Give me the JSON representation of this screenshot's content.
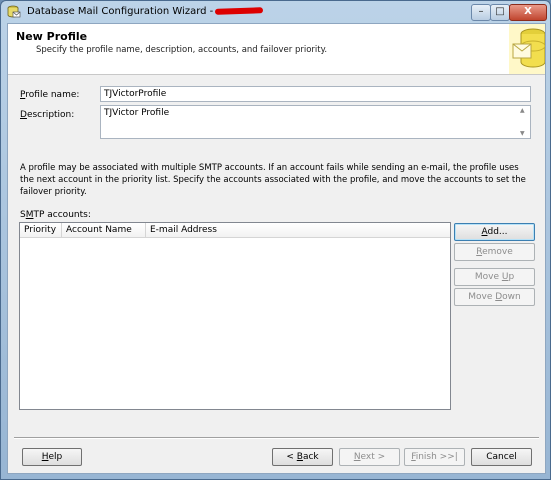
{
  "window": {
    "title": "Database Mail Configuration Wizard -",
    "min_label": "–",
    "max_label": "□",
    "close_label": "X"
  },
  "header": {
    "title": "New Profile",
    "subtitle": "Specify the profile name, description, accounts, and failover priority."
  },
  "form": {
    "profile_name_label_accel": "P",
    "profile_name_label_rest": "rofile name:",
    "profile_name_value": "TJVictorProfile",
    "description_label_accel": "D",
    "description_label_rest": "escription:",
    "description_value": "TJVictor Profile"
  },
  "info_text": "A profile may be associated with multiple SMTP accounts. If an account fails while sending an e-mail, the profile uses the next account in the priority list. Specify the accounts associated with the profile, and move the accounts to set the failover priority.",
  "smtp": {
    "label_pre": "S",
    "label_accel": "M",
    "label_rest": "TP accounts:",
    "columns": [
      "Priority",
      "Account Name",
      "E-mail Address"
    ],
    "rows": []
  },
  "side_buttons": {
    "add": {
      "accel": "A",
      "rest": "dd..."
    },
    "remove": {
      "accel": "R",
      "rest": "emove"
    },
    "move_up": {
      "pre": "Move ",
      "accel": "U",
      "rest": "p"
    },
    "move_down": {
      "pre": "Move ",
      "accel": "D",
      "rest": "own"
    }
  },
  "footer": {
    "help": {
      "accel": "H",
      "rest": "elp"
    },
    "back": {
      "pre": "< ",
      "accel": "B",
      "rest": "ack"
    },
    "next": {
      "accel": "N",
      "rest": "ext >"
    },
    "finish": {
      "accel": "F",
      "rest": "inish >>|"
    },
    "cancel": "Cancel"
  },
  "colors": {
    "title_bar": "#bcd3e8",
    "close_button": "#c0452e",
    "default_button_border": "#3c7fb1",
    "redaction": "#dd0000"
  },
  "icons": {
    "app": "database-mail-icon",
    "header": "database-envelope-icon"
  }
}
